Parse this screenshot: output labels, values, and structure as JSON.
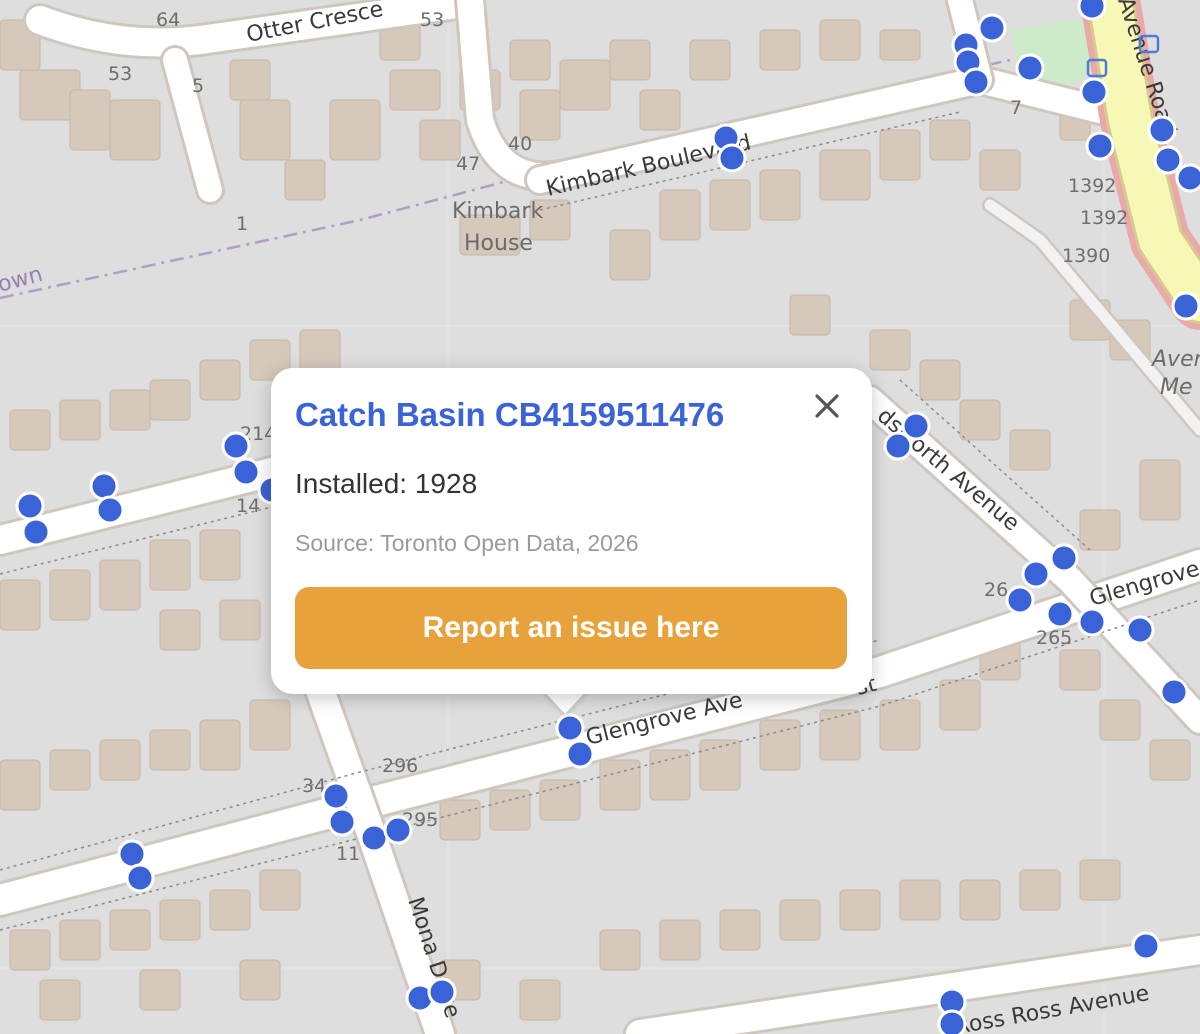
{
  "map": {
    "streets": {
      "otter_crescent": "Otter Cresce",
      "kimbark_boulevard": "Kimbark Boulevard",
      "glengrove_avenue_west": "Glengrove Ave",
      "glengrove_avenue_west_tail": "st",
      "glengrove_avenue_east": "Glengrove",
      "woodsworth_avenue": "dsworth Avenue",
      "mona_drive": "Mona Drive",
      "avenue_road": "Avenue Road",
      "bottom_avenue": "Ross Ross Avenue",
      "district_fragment": "own"
    },
    "poi": {
      "name_line1": "Kimbark",
      "name_line2": "House",
      "side_fragment_1": "Aven",
      "side_fragment_2": "Me"
    },
    "house_numbers": [
      "64",
      "53",
      "53",
      "5",
      "1",
      "40",
      "47",
      "7",
      "1392",
      "1392",
      "1390",
      "214",
      "14",
      "296",
      "295",
      "34",
      "11",
      "26",
      "265"
    ],
    "colors": {
      "land": "#dedede",
      "road": "#ffffff",
      "road_casing": "#cfc7be",
      "building": "#d6c8ba",
      "building_outline": "#c6b6a6",
      "park": "#cdebc9",
      "primary_road": "#f7f7b6",
      "primary_road_casing": "#d8c991",
      "marker_fill": "#3b63d8",
      "marker_stroke": "#ffffff",
      "boundary": "#b59cc6"
    }
  },
  "markers_icon": "catch-basin-point-icon",
  "popup": {
    "title": "Catch Basin CB4159511476",
    "installed": "Installed: 1928",
    "source": "Source: Toronto Open Data, 2026",
    "report_button_label": "Report an issue here",
    "report_button_color": "#e8a23b",
    "close_icon": "close-icon"
  }
}
